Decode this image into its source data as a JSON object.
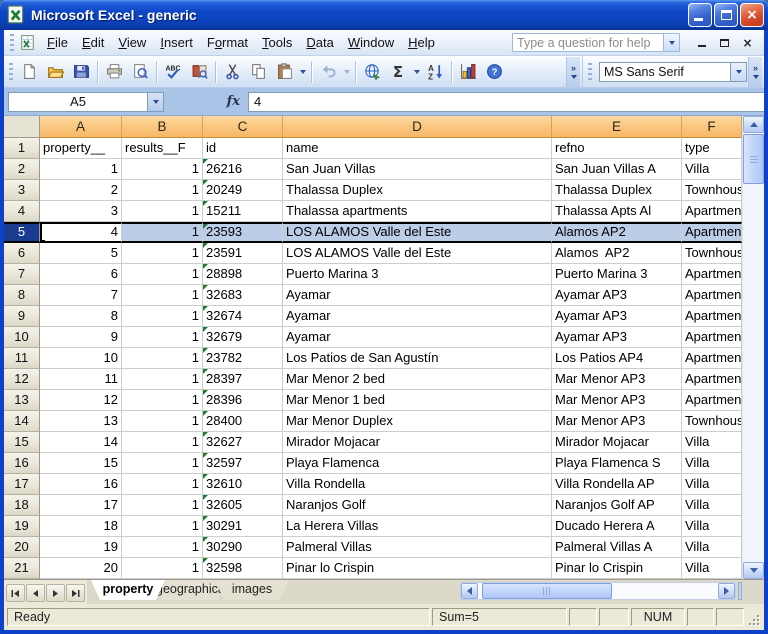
{
  "window": {
    "title": "Microsoft Excel - generic"
  },
  "menu_bar": {
    "items": [
      {
        "label": "File",
        "underline": 0
      },
      {
        "label": "Edit",
        "underline": 0
      },
      {
        "label": "View",
        "underline": 0
      },
      {
        "label": "Insert",
        "underline": 0
      },
      {
        "label": "Format",
        "underline": 1
      },
      {
        "label": "Tools",
        "underline": 0
      },
      {
        "label": "Data",
        "underline": 0
      },
      {
        "label": "Window",
        "underline": 0
      },
      {
        "label": "Help",
        "underline": 0
      }
    ],
    "help_box_placeholder": "Type a question for help"
  },
  "toolbar": {
    "standard_icons": [
      "new-workbook",
      "open-folder",
      "save",
      "print",
      "print-preview",
      "spelling",
      "research",
      "cut",
      "copy",
      "paste",
      "undo",
      "insert-hyperlink",
      "autosum",
      "sort-ascending",
      "chart-wizard",
      "help"
    ],
    "autosum_glyph": "Σ",
    "font_combo_value": "MS Sans Serif"
  },
  "formula_bar": {
    "name_box": "A5",
    "fx": "fx",
    "value": "4"
  },
  "grid": {
    "column_letters": [
      "A",
      "B",
      "C",
      "D",
      "E",
      "F"
    ],
    "selected_row_num": "5",
    "active_cell": "A5",
    "rows": [
      {
        "num": "1",
        "cells": [
          "property__",
          "results__F",
          "id",
          "name",
          "refno",
          "type"
        ]
      },
      {
        "num": "2",
        "cells": [
          "1",
          "1",
          "26216",
          "San Juan Villas",
          "San Juan Villas A",
          "Villa"
        ]
      },
      {
        "num": "3",
        "cells": [
          "2",
          "1",
          "20249",
          "Thalassa Duplex",
          "Thalassa Duplex",
          "Townhouse"
        ]
      },
      {
        "num": "4",
        "cells": [
          "3",
          "1",
          "15211",
          "Thalassa apartments",
          "Thalassa Apts Al",
          "Apartment"
        ]
      },
      {
        "num": "5",
        "cells": [
          "4",
          "1",
          "23593",
          "LOS ALAMOS Valle del Este",
          "Alamos AP2",
          "Apartment"
        ]
      },
      {
        "num": "6",
        "cells": [
          "5",
          "1",
          "23591",
          "LOS ALAMOS Valle del Este",
          "Alamos  AP2",
          "Townhouse"
        ]
      },
      {
        "num": "7",
        "cells": [
          "6",
          "1",
          "28898",
          "Puerto Marina 3",
          "Puerto Marina 3",
          "Apartment"
        ]
      },
      {
        "num": "8",
        "cells": [
          "7",
          "1",
          "32683",
          "Ayamar",
          "Ayamar AP3",
          "Apartment"
        ]
      },
      {
        "num": "9",
        "cells": [
          "8",
          "1",
          "32674",
          "Ayamar",
          "Ayamar AP3",
          "Apartment"
        ]
      },
      {
        "num": "10",
        "cells": [
          "9",
          "1",
          "32679",
          "Ayamar",
          "Ayamar AP3",
          "Apartment"
        ]
      },
      {
        "num": "11",
        "cells": [
          "10",
          "1",
          "23782",
          "Los Patios de San Agustín",
          "Los Patios AP4",
          "Apartment"
        ]
      },
      {
        "num": "12",
        "cells": [
          "11",
          "1",
          "28397",
          "Mar Menor 2 bed",
          "Mar Menor AP3",
          "Apartment"
        ]
      },
      {
        "num": "13",
        "cells": [
          "12",
          "1",
          "28396",
          "Mar Menor 1 bed",
          "Mar Menor AP3",
          "Apartment"
        ]
      },
      {
        "num": "14",
        "cells": [
          "13",
          "1",
          "28400",
          "Mar Menor Duplex",
          "Mar Menor AP3",
          "Townhouse"
        ]
      },
      {
        "num": "15",
        "cells": [
          "14",
          "1",
          "32627",
          "Mirador Mojacar",
          "Mirador Mojacar",
          "Villa"
        ]
      },
      {
        "num": "16",
        "cells": [
          "15",
          "1",
          "32597",
          "Playa Flamenca",
          "Playa Flamenca S",
          "Villa"
        ]
      },
      {
        "num": "17",
        "cells": [
          "16",
          "1",
          "32610",
          "Villa Rondella",
          "Villa Rondella AP",
          "Villa"
        ]
      },
      {
        "num": "18",
        "cells": [
          "17",
          "1",
          "32605",
          "Naranjos Golf",
          "Naranjos Golf AP",
          "Villa"
        ]
      },
      {
        "num": "19",
        "cells": [
          "18",
          "1",
          "30291",
          "La Herera Villas",
          "Ducado Herera A",
          "Villa"
        ]
      },
      {
        "num": "20",
        "cells": [
          "19",
          "1",
          "30290",
          "Palmeral Villas",
          "Palmeral Villas A",
          "Villa"
        ]
      },
      {
        "num": "21",
        "cells": [
          "20",
          "1",
          "32598",
          "Pinar lo Crispin",
          "Pinar lo Crispin",
          "Villa"
        ]
      }
    ]
  },
  "sheet_tabs": {
    "tabs": [
      "property",
      "geographical",
      "images"
    ],
    "active_tab": "property"
  },
  "status_bar": {
    "mode": "Ready",
    "sum": "Sum=5",
    "keyboard": "NUM"
  }
}
